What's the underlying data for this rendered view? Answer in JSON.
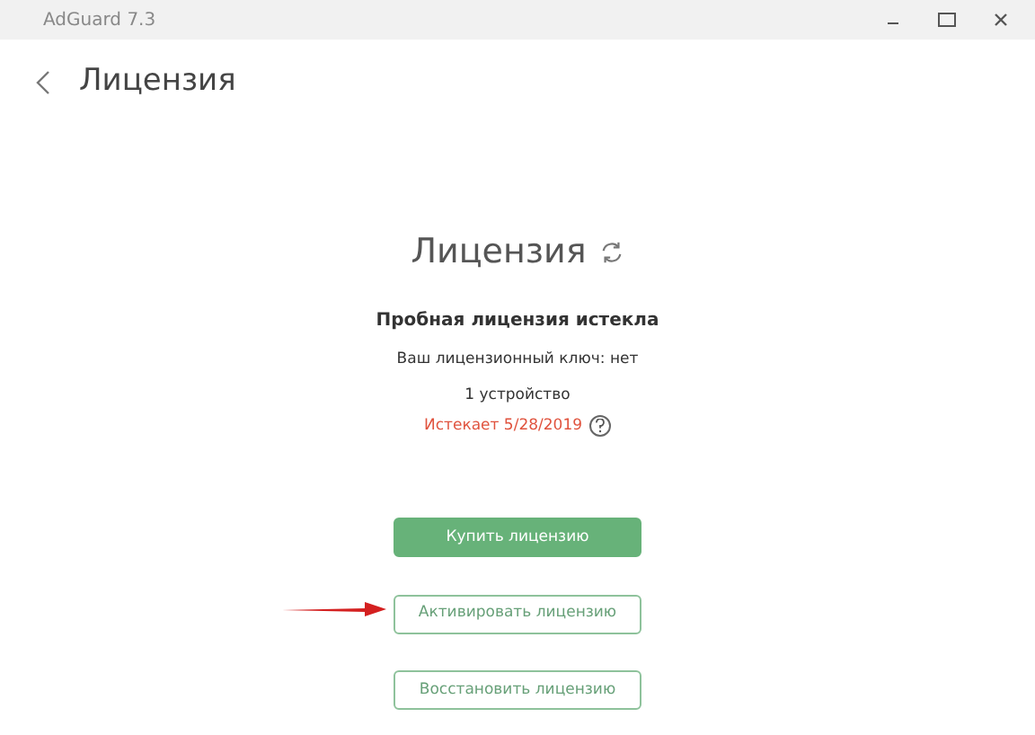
{
  "window": {
    "title": "AdGuard 7.3"
  },
  "header": {
    "title": "Лицензия"
  },
  "license": {
    "title": "Лицензия",
    "status": "Пробная лицензия истекла",
    "key": "Ваш лицензионный ключ: нет",
    "devices": "1 устройство",
    "expires": "Истекает 5/28/2019"
  },
  "buttons": [
    {
      "label": "Купить лицензию",
      "kind": "primary"
    },
    {
      "label": "Активировать лицензию",
      "kind": "arrowed"
    },
    {
      "label": "Восстановить лицензию",
      "kind": "outline"
    }
  ]
}
